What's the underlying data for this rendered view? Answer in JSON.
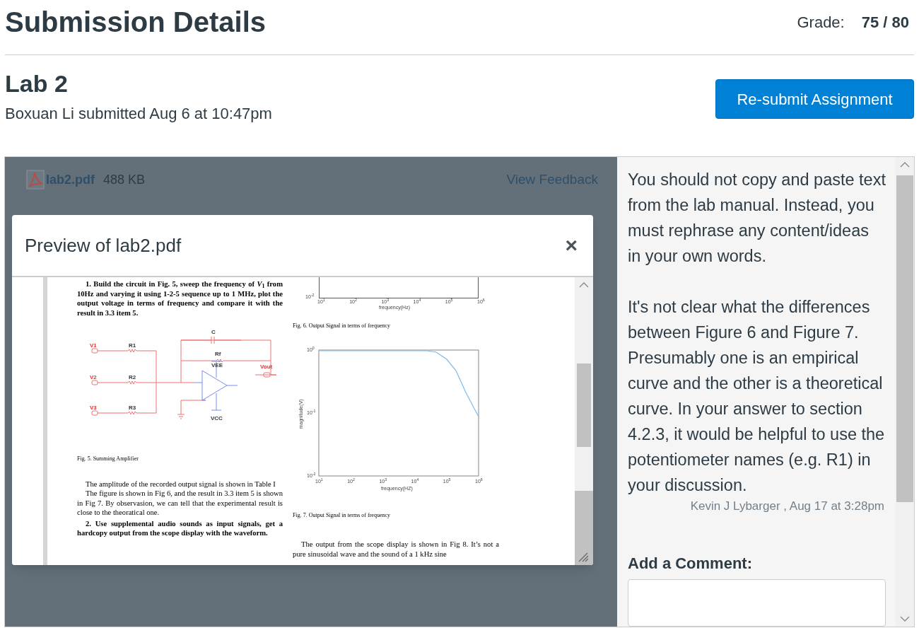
{
  "page_title": "Submission Details",
  "grade": {
    "label": "Grade:",
    "value": "75 / 80"
  },
  "assignment": {
    "title": "Lab 2",
    "submitted": "Boxuan Li submitted Aug 6 at 10:47pm",
    "button": "Re-submit Assignment"
  },
  "file": {
    "name": "lab2.pdf",
    "size": "488 KB",
    "feedback_link": "View Feedback"
  },
  "preview": {
    "title": "Preview of lab2.pdf",
    "close": "×",
    "left_column": [
      {
        "kind": "step",
        "text": "1. Build the circuit in Fig. 5, sweep the frequency of *V*$_{1}$ from 10Hz and varying it using 1-2-5 sequence up to 1 MHz, plot the output voltage in terms of frequency and compare it with the result in 3.3 item 5."
      },
      {
        "kind": "circuit",
        "labels": {
          "v1": "V1",
          "v2": "V2",
          "v3": "V3",
          "r1": "R1",
          "r2": "R2",
          "r3": "R3",
          "c": "C",
          "rf": "Rf",
          "vee": "VEE",
          "vcc": "VCC",
          "vout": "Vout"
        }
      },
      {
        "kind": "caption",
        "text": "Fig. 5.  Summing Amplifier"
      },
      {
        "kind": "para",
        "text": "The amplitude of the recorded output signal is shown in Table I"
      },
      {
        "kind": "para",
        "text": "The figure is shown in Fig 6, and the result in 3.3 item 5 is shown in Fig 7. By observasion, we can tell that the experimental result is close to the theoratical one."
      },
      {
        "kind": "step",
        "text": "2. Use supplemental audio sounds as input signals, get a hardcopy output from the scope display with the waveform."
      }
    ],
    "right_column": [
      {
        "kind": "axis",
        "y_tick": "10$^{-2}$",
        "x_ticks": [
          "10$^{1}$",
          "10$^{2}$",
          "10$^{3}$",
          "10$^{4}$",
          "10$^{5}$",
          "10$^{6}$"
        ],
        "xlabel": "frequency(Hz)"
      },
      {
        "kind": "caption",
        "text": "Fig. 6.  Output Signal in terms of frequency"
      },
      {
        "kind": "plot",
        "xlabel": "frequency(HZ)",
        "ylabel": "magnitude(V)",
        "x_ticks": [
          "10$^{1}$",
          "10$^{2}$",
          "10$^{3}$",
          "10$^{4}$",
          "10$^{5}$",
          "10$^{6}$"
        ],
        "y_ticks": [
          "10$^{0}$",
          "10$^{-1}$",
          "10$^{-2}$"
        ]
      },
      {
        "kind": "caption",
        "text": "Fig. 7.  Output Signal in terms of frequency"
      },
      {
        "kind": "para",
        "text": "The output from the scope display is shown in Fig 8. It’s not a pure sinusoidal wave and the sound of a 1 kHz sine"
      }
    ]
  },
  "comment": {
    "paragraphs": [
      "You should not copy and paste text from the lab manual. Instead, you must rephrase any content/ideas in your own words.",
      "It's not clear what the differences between Figure 6 and Figure 7. Presumably one is an empirical curve and the other is a theoretical curve. In your answer to section 4.2.3, it would be helpful to use the potentiometer names (e.g. R1) in your discussion."
    ],
    "author": "Kevin J Lybarger , Aug 17 at 3:28pm"
  },
  "add_comment": {
    "label": "Add a Comment:"
  }
}
